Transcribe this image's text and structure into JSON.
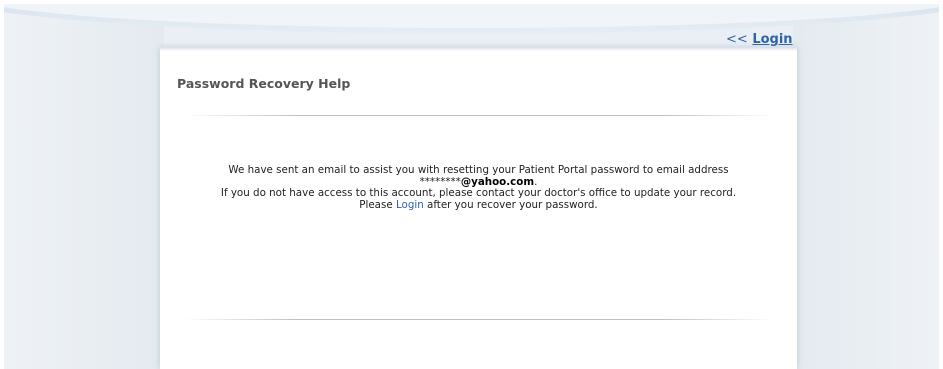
{
  "nav": {
    "back_arrows": "<<",
    "back_label": "Login"
  },
  "card": {
    "title": "Password Recovery Help",
    "message": {
      "line1": "We have sent an email to assist you with resetting your Patient Portal password to email address",
      "email_masked": "********",
      "email_domain": "@yahoo.com",
      "email_suffix": ".",
      "line3": "If you do not have access to this account, please contact your doctor's office to update your record.",
      "line4_prefix": "Please",
      "line4_link": "Login",
      "line4_suffix": "after you recover your password."
    }
  },
  "colors": {
    "link": "#2e64a8",
    "title_text": "#555555",
    "body_text": "#222222",
    "card_background": "#ffffff",
    "page_background": "#eef2f6"
  }
}
